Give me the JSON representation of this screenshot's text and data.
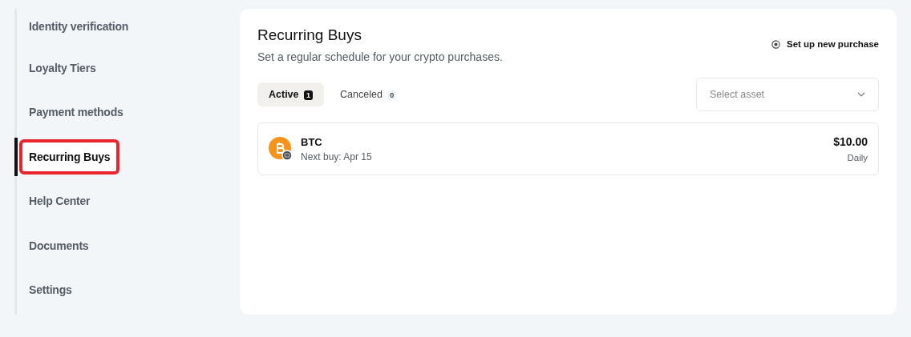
{
  "sidebar": {
    "items": [
      {
        "label": "Identity verification",
        "selected": false,
        "highlighted": false
      },
      {
        "label": "Loyalty Tiers",
        "selected": false,
        "highlighted": false
      },
      {
        "label": "Payment methods",
        "selected": false,
        "highlighted": false
      },
      {
        "label": "Recurring Buys",
        "selected": true,
        "highlighted": true
      },
      {
        "label": "Help Center",
        "selected": false,
        "highlighted": false
      },
      {
        "label": "Documents",
        "selected": false,
        "highlighted": false
      },
      {
        "label": "Settings",
        "selected": false,
        "highlighted": false
      }
    ]
  },
  "header": {
    "title": "Recurring Buys",
    "subtitle": "Set a regular schedule for your crypto purchases.",
    "action": "Set up new purchase"
  },
  "tabs": [
    {
      "label": "Active",
      "count": "1",
      "selected": true
    },
    {
      "label": "Canceled",
      "count": "0",
      "selected": false
    }
  ],
  "asset_select": {
    "placeholder": "Select asset"
  },
  "purchases": [
    {
      "symbol": "BTC",
      "next_buy": "Next buy: Apr 15",
      "amount": "$10.00",
      "frequency": "Daily"
    }
  ]
}
